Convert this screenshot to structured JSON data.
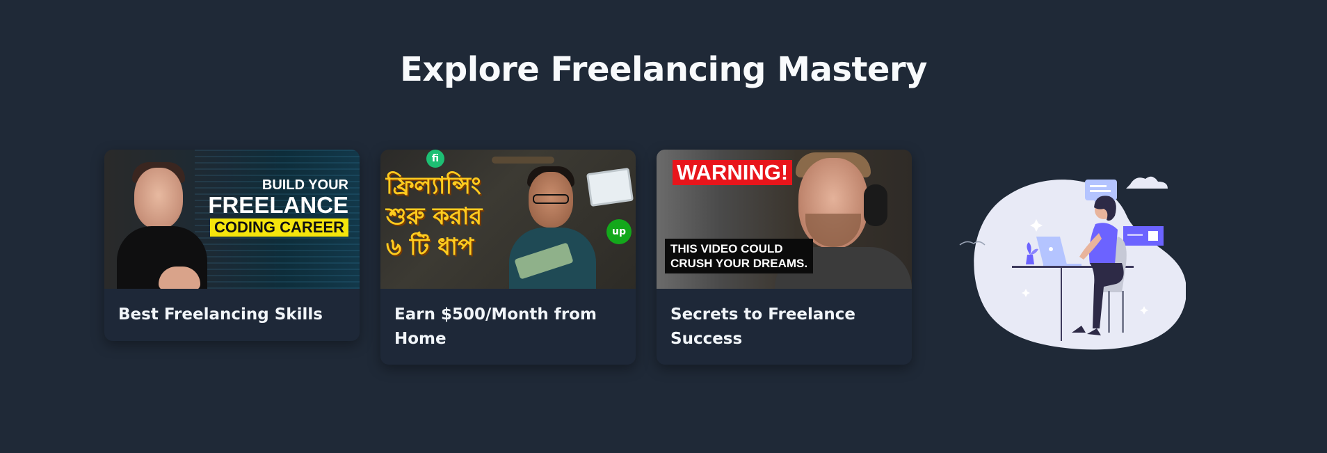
{
  "section": {
    "title": "Explore Freelancing Mastery"
  },
  "cards": [
    {
      "title": "Best Freelancing Skills",
      "thumbnail": {
        "line1": "BUILD YOUR",
        "line2": "FREELANCE",
        "line3": "CODING CAREER"
      }
    },
    {
      "title": "Earn $500/Month from Home",
      "thumbnail": {
        "bengali_text": "ফ্রিল্যান্সিং শুরু করার ৬ টি ধাপ",
        "badge_fiverr": "fi",
        "badge_upwork": "up"
      }
    },
    {
      "title": "Secrets to Freelance Success",
      "thumbnail": {
        "warning": "WARNING!",
        "caption_line1": "THIS VIDEO COULD",
        "caption_line2": "CRUSH YOUR DREAMS."
      }
    }
  ],
  "colors": {
    "background": "#1f2937",
    "card": "#1e2838",
    "illustration_blob": "#e8eaf6",
    "illustration_accent": "#6c63ff"
  },
  "icons": {
    "illustration": "woman-working-on-laptop-illustration"
  }
}
